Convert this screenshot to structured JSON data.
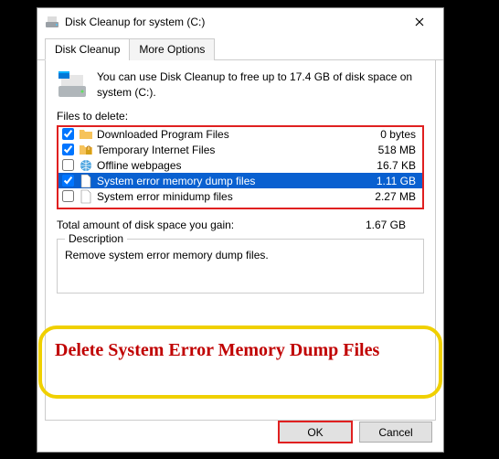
{
  "window": {
    "title": "Disk Cleanup for system (C:)"
  },
  "tabs": {
    "cleanup": "Disk Cleanup",
    "more": "More Options"
  },
  "info": {
    "text": "You can use Disk Cleanup to free up to 17.4 GB of disk space on system (C:)."
  },
  "files_label": "Files to delete:",
  "file_items": [
    {
      "name": "Downloaded Program Files",
      "size": "0 bytes",
      "checked": true,
      "selected": false,
      "icon": "folder"
    },
    {
      "name": "Temporary Internet Files",
      "size": "518 MB",
      "checked": true,
      "selected": false,
      "icon": "lock-folder"
    },
    {
      "name": "Offline webpages",
      "size": "16.7 KB",
      "checked": false,
      "selected": false,
      "icon": "globe"
    },
    {
      "name": "System error memory dump files",
      "size": "1.11 GB",
      "checked": true,
      "selected": true,
      "icon": "file"
    },
    {
      "name": "System error minidump files",
      "size": "2.27 MB",
      "checked": false,
      "selected": false,
      "icon": "file"
    }
  ],
  "total": {
    "label": "Total amount of disk space you gain:",
    "value": "1.67 GB"
  },
  "description": {
    "legend": "Description",
    "text": "Remove system error memory dump files."
  },
  "annotation": "Delete System Error Memory Dump Files",
  "buttons": {
    "ok": "OK",
    "cancel": "Cancel"
  }
}
